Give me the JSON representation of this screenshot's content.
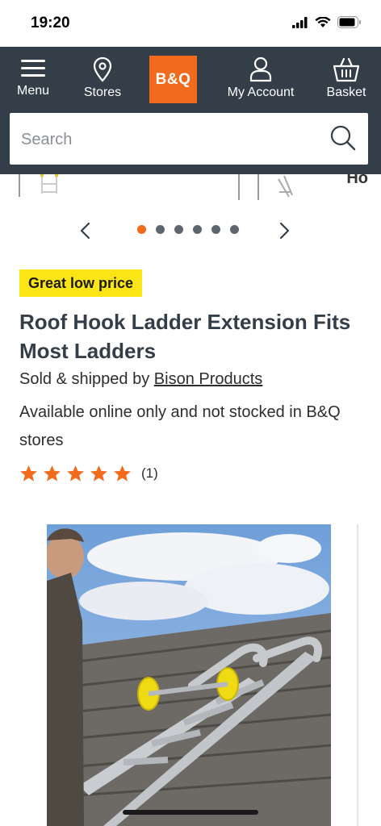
{
  "status_bar": {
    "time": "19:20"
  },
  "header": {
    "nav": {
      "menu": "Menu",
      "stores": "Stores",
      "logo": "B&Q",
      "account": "My Account",
      "basket": "Basket"
    },
    "search": {
      "placeholder": "Search"
    },
    "brand_color": "#f26b1d",
    "header_color": "#333e48"
  },
  "carousel": {
    "peek_text": "Ho",
    "total_dots": 6,
    "active_dot": 0
  },
  "product": {
    "badge": "Great low price",
    "title": "Roof Hook Ladder Extension Fits Most Ladders",
    "seller_prefix": "Sold & shipped by",
    "seller_name": "Bison Products",
    "availability": "Available online only and not stocked in B&Q stores",
    "rating_value": 5,
    "rating_count": "(1)"
  }
}
